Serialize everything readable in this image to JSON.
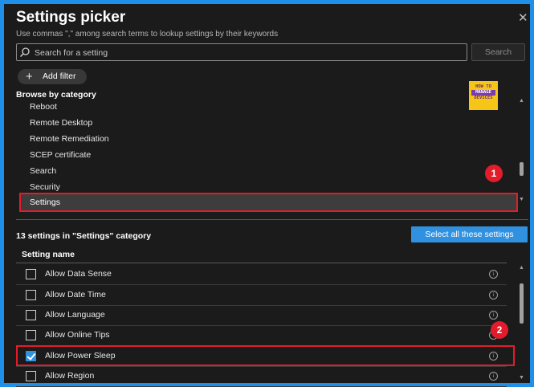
{
  "dialog": {
    "title": "Settings picker",
    "subtitle": "Use commas \",\" among search terms to lookup settings by their keywords",
    "close_icon": "close-icon"
  },
  "search": {
    "placeholder": "Search for a setting",
    "value": "",
    "button_label": "Search"
  },
  "filter": {
    "add_label": "Add filter"
  },
  "browse": {
    "label": "Browse by category",
    "items": [
      "Reboot",
      "Remote Desktop",
      "Remote Remediation",
      "SCEP certificate",
      "Search",
      "Security",
      "Settings"
    ],
    "selected": "Settings"
  },
  "logo": {
    "line1": "HOW TO",
    "line2": "MANAGE",
    "line3": "DEVICES"
  },
  "badges": {
    "one": "1",
    "two": "2"
  },
  "results": {
    "count_label": "13 settings in \"Settings\" category",
    "select_all_label": "Select all these settings",
    "column_header": "Setting name",
    "rows": [
      {
        "name": "Allow Data Sense",
        "checked": false
      },
      {
        "name": "Allow Date Time",
        "checked": false
      },
      {
        "name": "Allow Language",
        "checked": false
      },
      {
        "name": "Allow Online Tips",
        "checked": false
      },
      {
        "name": "Allow Power Sleep",
        "checked": true
      },
      {
        "name": "Allow Region",
        "checked": false
      }
    ]
  },
  "colors": {
    "accent": "#2f91e0",
    "frame": "#1f8fe8",
    "highlight": "#e21d2b",
    "background": "#1b1b1b"
  }
}
